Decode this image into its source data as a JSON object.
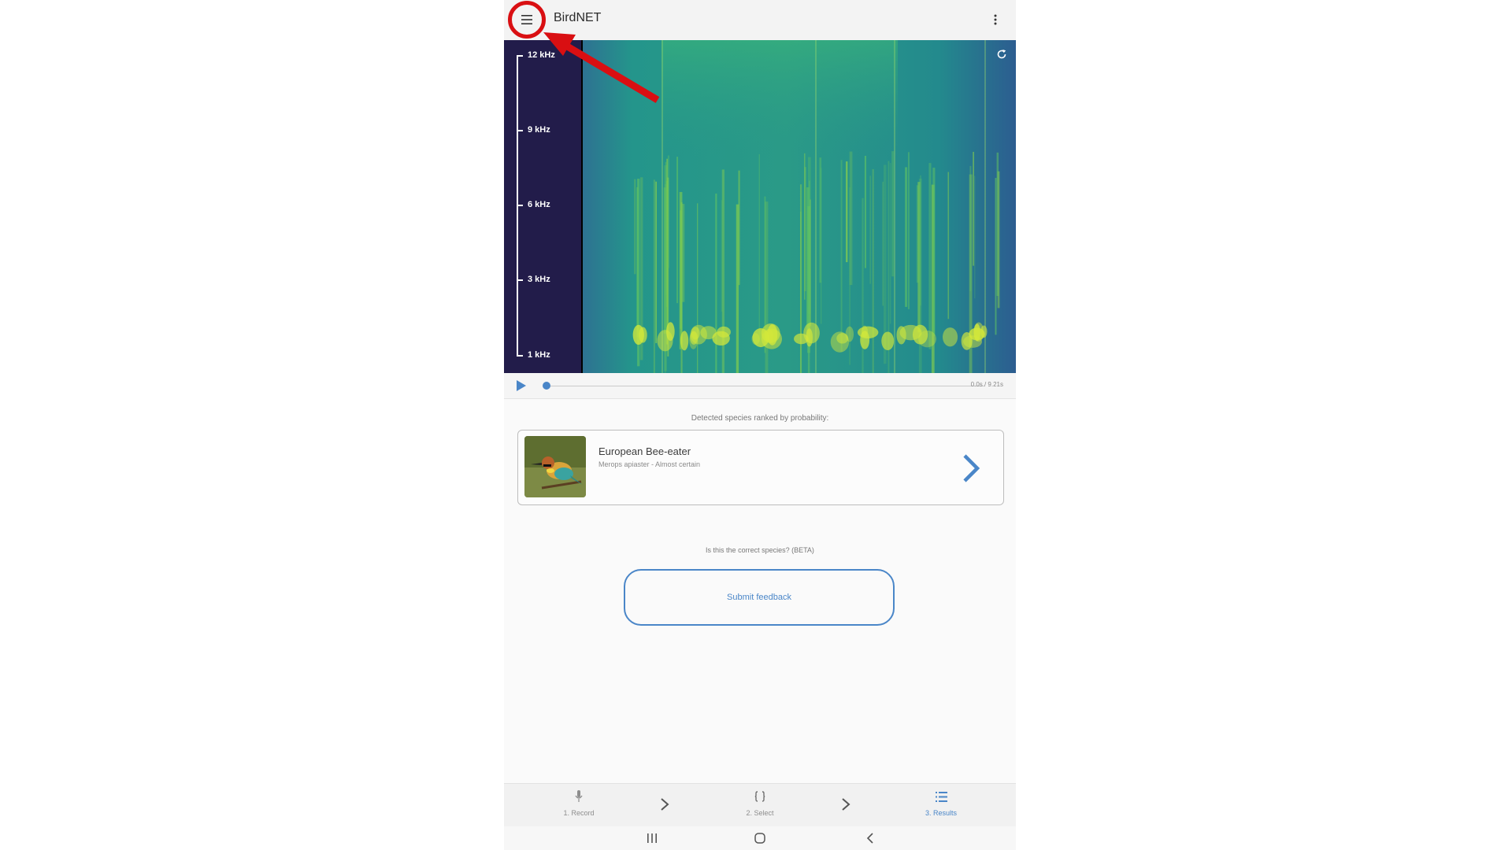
{
  "app_bar": {
    "title": "BirdNET",
    "menu_icon": "hamburger-menu-icon",
    "overflow_icon": "more-vert-icon"
  },
  "spectrogram": {
    "frequency_labels": [
      "12 kHz",
      "9 kHz",
      "6 kHz",
      "3 kHz",
      "1 kHz"
    ],
    "refresh_icon": "refresh-icon"
  },
  "player": {
    "play_icon": "play-icon",
    "progress": 0.0,
    "time_text": "0.0s / 9.21s"
  },
  "results": {
    "heading": "Detected species ranked by probability:",
    "species": [
      {
        "common_name": "European Bee-eater",
        "subtitle": "Merops apiaster - Almost certain"
      }
    ],
    "feedback_question": "Is this the correct species? (BETA)",
    "feedback_button": "Submit feedback"
  },
  "bottom_nav": {
    "steps": [
      {
        "label": "1. Record",
        "icon": "microphone-icon",
        "active": false
      },
      {
        "label": "2. Select",
        "icon": "braces-icon",
        "active": false
      },
      {
        "label": "3. Results",
        "icon": "list-icon",
        "active": true
      }
    ]
  },
  "colors": {
    "accent": "#4a86c8",
    "annotation": "#d90f12",
    "spectro_axis_bg": "#221c4a"
  }
}
